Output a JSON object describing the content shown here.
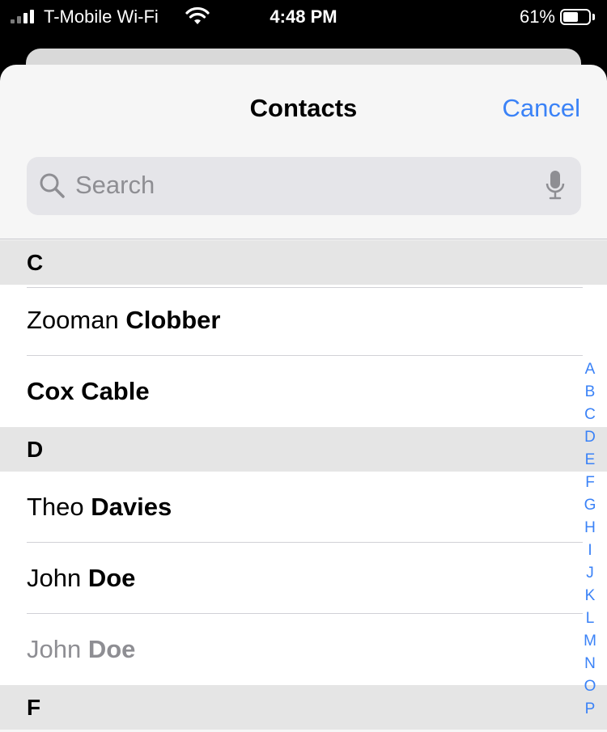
{
  "status_bar": {
    "carrier": "T-Mobile Wi-Fi",
    "time": "4:48 PM",
    "battery_percent": "61%",
    "battery_level": 0.61
  },
  "nav": {
    "title": "Contacts",
    "cancel_label": "Cancel"
  },
  "search": {
    "placeholder": "Search"
  },
  "sections": [
    {
      "letter": "C",
      "contacts": [
        {
          "first": "Zooman ",
          "last": "Clobber",
          "dim": false
        },
        {
          "first": "",
          "last": "Cox Cable",
          "dim": false
        }
      ]
    },
    {
      "letter": "D",
      "contacts": [
        {
          "first": "Theo ",
          "last": "Davies",
          "dim": false
        },
        {
          "first": "John ",
          "last": "Doe",
          "dim": false
        },
        {
          "first": "John ",
          "last": "Doe",
          "dim": true
        }
      ]
    },
    {
      "letter": "F",
      "contacts": []
    }
  ],
  "index_letters": [
    "A",
    "B",
    "C",
    "D",
    "E",
    "F",
    "G",
    "H",
    "I",
    "J",
    "K",
    "L",
    "M",
    "N",
    "O",
    "P"
  ],
  "colors": {
    "accent": "#3a82f7",
    "section_bg": "#e5e5e5",
    "dim_text": "#8e8e93"
  }
}
